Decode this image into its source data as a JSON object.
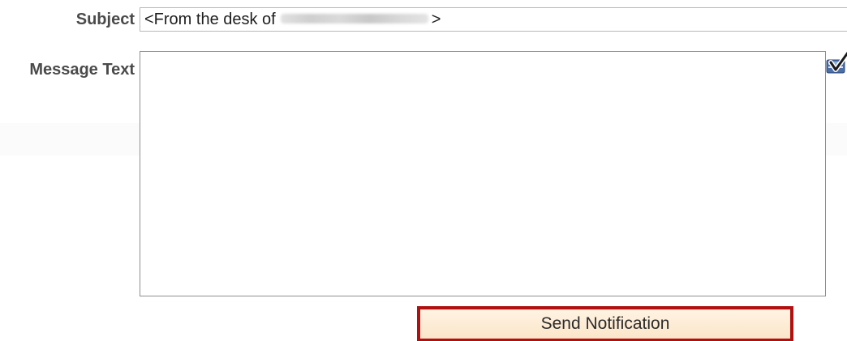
{
  "form": {
    "subject_label": "Subject",
    "subject_prefix": "<From the desk of",
    "subject_suffix": ">",
    "message_label": "Message Text",
    "message_value": ""
  },
  "actions": {
    "send_label": "Send Notification"
  },
  "icons": {
    "spell_check": "spell-check-icon"
  },
  "colors": {
    "button_border": "#b01010",
    "button_background": "#fff0dc",
    "label_text": "#4a4a4a"
  }
}
